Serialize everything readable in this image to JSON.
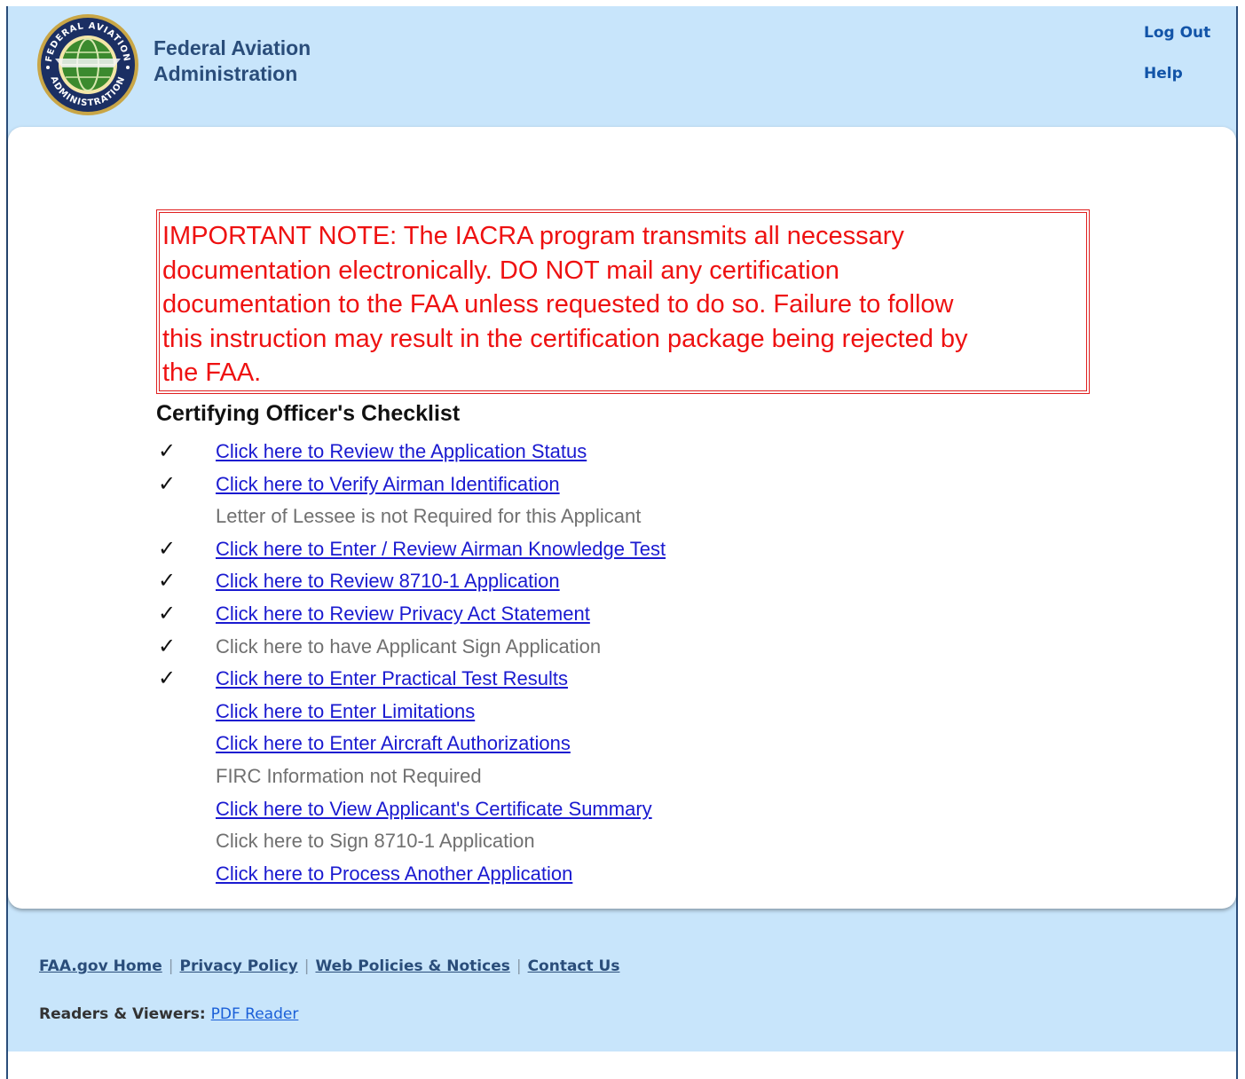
{
  "header": {
    "org_line1": "Federal Aviation",
    "org_line2": "Administration",
    "logo_icon": "faa-seal-icon",
    "logo_text_top": "FEDERAL AVIATION",
    "logo_text_bottom": "ADMINISTRATION",
    "logout_label": "Log Out",
    "help_label": "Help"
  },
  "notice": {
    "line1": "IMPORTANT NOTE: The IACRA program transmits all necessary",
    "line2": "documentation electronically. DO NOT mail any certification",
    "line3": "documentation to the FAA unless requested to do so. Failure to follow",
    "line4": "this instruction may result in the certification package being rejected by",
    "line5": "the FAA."
  },
  "checklist": {
    "title": "Certifying Officer's Checklist",
    "check_glyph": "✓",
    "items": [
      {
        "checked": true,
        "label": "Click here to Review the Application Status",
        "link": true
      },
      {
        "checked": true,
        "label": "Click here to Verify Airman Identification",
        "link": true
      },
      {
        "checked": false,
        "label": "Letter of Lessee is not Required for this Applicant",
        "link": false
      },
      {
        "checked": true,
        "label": "Click here to Enter / Review Airman Knowledge Test",
        "link": true
      },
      {
        "checked": true,
        "label": "Click here to Review 8710-1 Application",
        "link": true
      },
      {
        "checked": true,
        "label": "Click here to Review Privacy Act Statement",
        "link": true
      },
      {
        "checked": true,
        "label": "Click here to have Applicant Sign Application",
        "link": false
      },
      {
        "checked": true,
        "label": "Click here to Enter Practical Test Results",
        "link": true
      },
      {
        "checked": false,
        "label": "Click here to Enter Limitations",
        "link": true
      },
      {
        "checked": false,
        "label": "Click here to Enter Aircraft Authorizations",
        "link": true
      },
      {
        "checked": false,
        "label": "FIRC Information not Required",
        "link": false
      },
      {
        "checked": false,
        "label": "Click here to View Applicant's Certificate Summary",
        "link": true
      },
      {
        "checked": false,
        "label": "Click here to Sign 8710-1 Application",
        "link": false
      },
      {
        "checked": false,
        "label": "Click here to Process Another Application",
        "link": true
      }
    ]
  },
  "footer": {
    "links": [
      "FAA.gov Home",
      "Privacy Policy",
      "Web Policies & Notices",
      "Contact Us"
    ],
    "separator": "|",
    "readers_label": "Readers & Viewers:",
    "pdf_reader_label": "PDF Reader"
  },
  "colors": {
    "header_bg": "#c8e5fb",
    "notice_red": "#ee1111",
    "link_blue": "#1a1ad0",
    "disabled_gray": "#707070",
    "brand_navy": "#2a4d7a"
  }
}
